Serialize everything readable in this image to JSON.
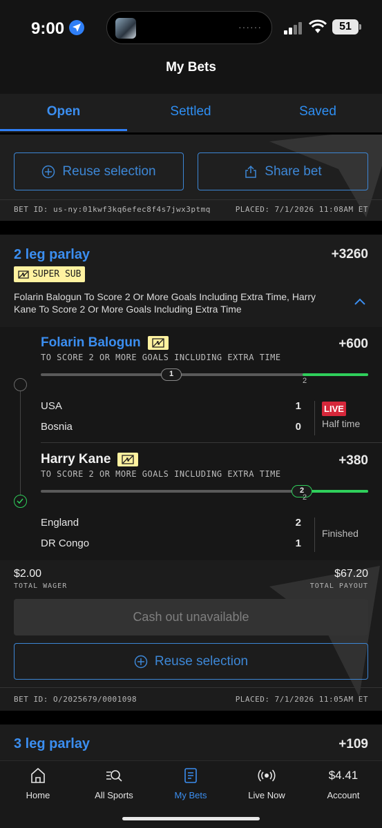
{
  "status": {
    "time": "9:00",
    "battery": "51"
  },
  "header": {
    "title": "My Bets"
  },
  "tabs": [
    {
      "label": "Open",
      "active": true
    },
    {
      "label": "Settled",
      "active": false
    },
    {
      "label": "Saved",
      "active": false
    }
  ],
  "bet1": {
    "reuse_label": "Reuse selection",
    "share_label": "Share bet",
    "bet_id": "BET ID: us-ny:01kwf3kq6efec8f4s7jwx3ptmq",
    "placed": "PLACED: 7/1/2026 11:08AM ET"
  },
  "bet2": {
    "title": "2 leg parlay",
    "odds": "+3260",
    "badge": "SUPER SUB",
    "description": "Folarin Balogun To Score 2 Or More Goals Including Extra Time, Harry Kane To Score 2 Or More Goals Including Extra Time",
    "legs": [
      {
        "player": "Folarin Balogun",
        "odds": "+600",
        "market": "TO SCORE 2 OR MORE GOALS INCLUDING EXTRA TIME",
        "progress_current": "1",
        "progress_target": "2",
        "progress_fraction": 0.5,
        "teams": [
          {
            "name": "USA",
            "score": "1"
          },
          {
            "name": "Bosnia",
            "score": "0"
          }
        ],
        "live": "LIVE",
        "status": "Half time"
      },
      {
        "player": "Harry Kane",
        "odds": "+380",
        "market": "TO SCORE 2 OR MORE GOALS INCLUDING EXTRA TIME",
        "progress_current": "2",
        "progress_target": "2",
        "progress_fraction": 1.0,
        "teams": [
          {
            "name": "England",
            "score": "2"
          },
          {
            "name": "DR Congo",
            "score": "1"
          }
        ],
        "status": "Finished"
      }
    ],
    "total_wager": "$2.00",
    "total_wager_label": "TOTAL WAGER",
    "total_payout": "$67.20",
    "total_payout_label": "TOTAL PAYOUT",
    "cashout_label": "Cash out unavailable",
    "reuse_label": "Reuse selection",
    "bet_id": "BET ID: O/2025679/0001098",
    "placed": "PLACED: 7/1/2026 11:05AM ET"
  },
  "bet3": {
    "title": "3 leg parlay",
    "odds": "+109"
  },
  "nav": [
    {
      "label": "Home",
      "icon": "home-icon"
    },
    {
      "label": "All Sports",
      "icon": "search-icon"
    },
    {
      "label": "My Bets",
      "icon": "bet-slip-icon",
      "active": true
    },
    {
      "label": "Live Now",
      "icon": "live-icon"
    },
    {
      "label": "Account",
      "value": "$4.41"
    }
  ],
  "colors": {
    "accent": "#3b8ef0",
    "live": "#d6273a",
    "progress": "#2fcf5b",
    "super_sub": "#fff2a0"
  }
}
